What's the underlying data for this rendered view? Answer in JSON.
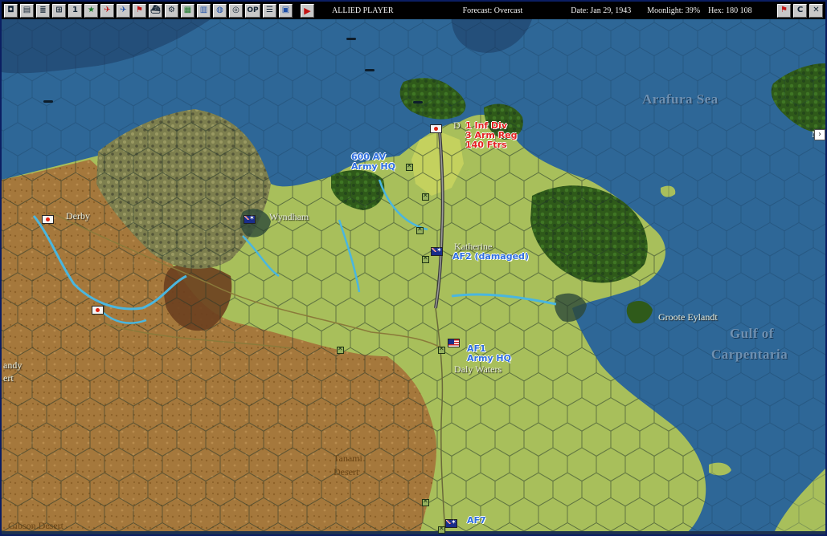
{
  "toolbar": {
    "buttons": [
      {
        "name": "new-game-button",
        "glyph": "◘"
      },
      {
        "name": "report-button",
        "glyph": "▤"
      },
      {
        "name": "list-button",
        "glyph": "≣"
      },
      {
        "name": "cycle-button",
        "glyph": "⊞"
      },
      {
        "name": "info-button",
        "glyph": "1"
      },
      {
        "name": "star-button",
        "glyph": "★"
      },
      {
        "name": "air-red-button",
        "glyph": "✈"
      },
      {
        "name": "air-blue-button",
        "glyph": "✈"
      },
      {
        "name": "flag-button",
        "glyph": "⚑"
      },
      {
        "name": "ship-button",
        "glyph": "⛴"
      },
      {
        "name": "settings-button",
        "glyph": "⚙"
      },
      {
        "name": "map-button",
        "glyph": "▦"
      },
      {
        "name": "chart-button",
        "glyph": "▥"
      },
      {
        "name": "globe-button",
        "glyph": "◍"
      },
      {
        "name": "target-button",
        "glyph": "◎"
      },
      {
        "name": "op-button",
        "glyph": "OP"
      },
      {
        "name": "menu-button",
        "glyph": "☰"
      },
      {
        "name": "view-button",
        "glyph": "▣"
      }
    ],
    "play_glyph": "▶",
    "player": "ALLIED PLAYER",
    "forecast": "Forecast: Overcast",
    "date": "Date: Jan 29, 1943",
    "moonlight": "Moonlight: 39%",
    "hex": "Hex: 180 108",
    "right_buttons": [
      {
        "name": "flag-end-turn-button",
        "glyph": "⚑"
      },
      {
        "name": "c-button",
        "glyph": "C"
      },
      {
        "name": "close-button",
        "glyph": "✕"
      }
    ]
  },
  "map": {
    "places": [
      {
        "name": "Derby",
        "text": "Derby"
      },
      {
        "name": "Wyndham",
        "text": "Wyndham"
      },
      {
        "name": "Katherine",
        "text": "Katherine"
      },
      {
        "name": "Daly Waters",
        "text": "Daly Waters"
      },
      {
        "name": "Groote Eylandt",
        "text": "Groote Eylandt"
      },
      {
        "name": "Darwin partial",
        "text": "D"
      },
      {
        "name": "Me partial",
        "text": "Me"
      },
      {
        "name": "Sandy partial",
        "text": "andy"
      },
      {
        "name": "Desert partial",
        "text": "ert"
      }
    ],
    "seas": {
      "arafura": "Arafura Sea",
      "gulf_line1": "Gulf of",
      "gulf_line2": "Carpentaria"
    },
    "deserts": {
      "tanami_line1": "Tanami",
      "tanami_line2": "Desert",
      "gibson": "Gibson Desert"
    },
    "units": {
      "darwin_red": [
        "1 Inf Div",
        "3 Arm Reg",
        "140 Ftrs"
      ],
      "darwin_blue": [
        "600 AV",
        "Army HQ"
      ],
      "katherine_blue": "AF2 (damaged)",
      "daly_blue": [
        "AF1",
        "Army HQ"
      ],
      "bottom_blue": "AF7"
    }
  }
}
